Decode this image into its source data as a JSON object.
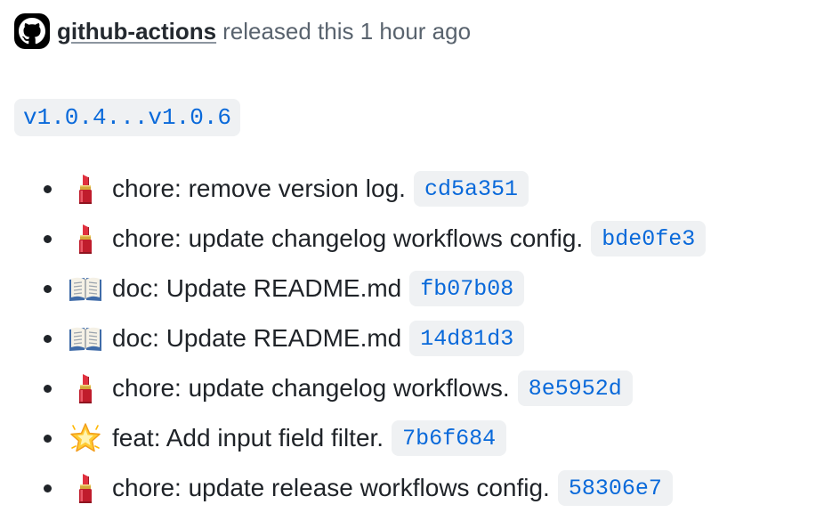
{
  "release": {
    "author": "github-actions",
    "author_icon": "github-mark-icon",
    "action_text": "released this 1 hour ago",
    "compare_link": "v1.0.4...v1.0.6"
  },
  "commits": [
    {
      "icon": "lipstick-icon",
      "message": "chore: remove version log.",
      "sha": "cd5a351"
    },
    {
      "icon": "lipstick-icon",
      "message": "chore: update changelog workflows config.",
      "sha": "bde0fe3"
    },
    {
      "icon": "open-book-icon",
      "message": "doc: Update README.md",
      "sha": "fb07b08"
    },
    {
      "icon": "open-book-icon",
      "message": "doc: Update README.md",
      "sha": "14d81d3"
    },
    {
      "icon": "lipstick-icon",
      "message": "chore: update changelog workflows.",
      "sha": "8e5952d"
    },
    {
      "icon": "glowing-star-icon",
      "message": "feat: Add input field filter.",
      "sha": "7b6f684"
    },
    {
      "icon": "lipstick-icon",
      "message": "chore: update release workflows config.",
      "sha": "58306e7"
    }
  ],
  "colors": {
    "link": "#0969da",
    "chip_background": "#eff1f3",
    "muted_text": "#59636e"
  }
}
